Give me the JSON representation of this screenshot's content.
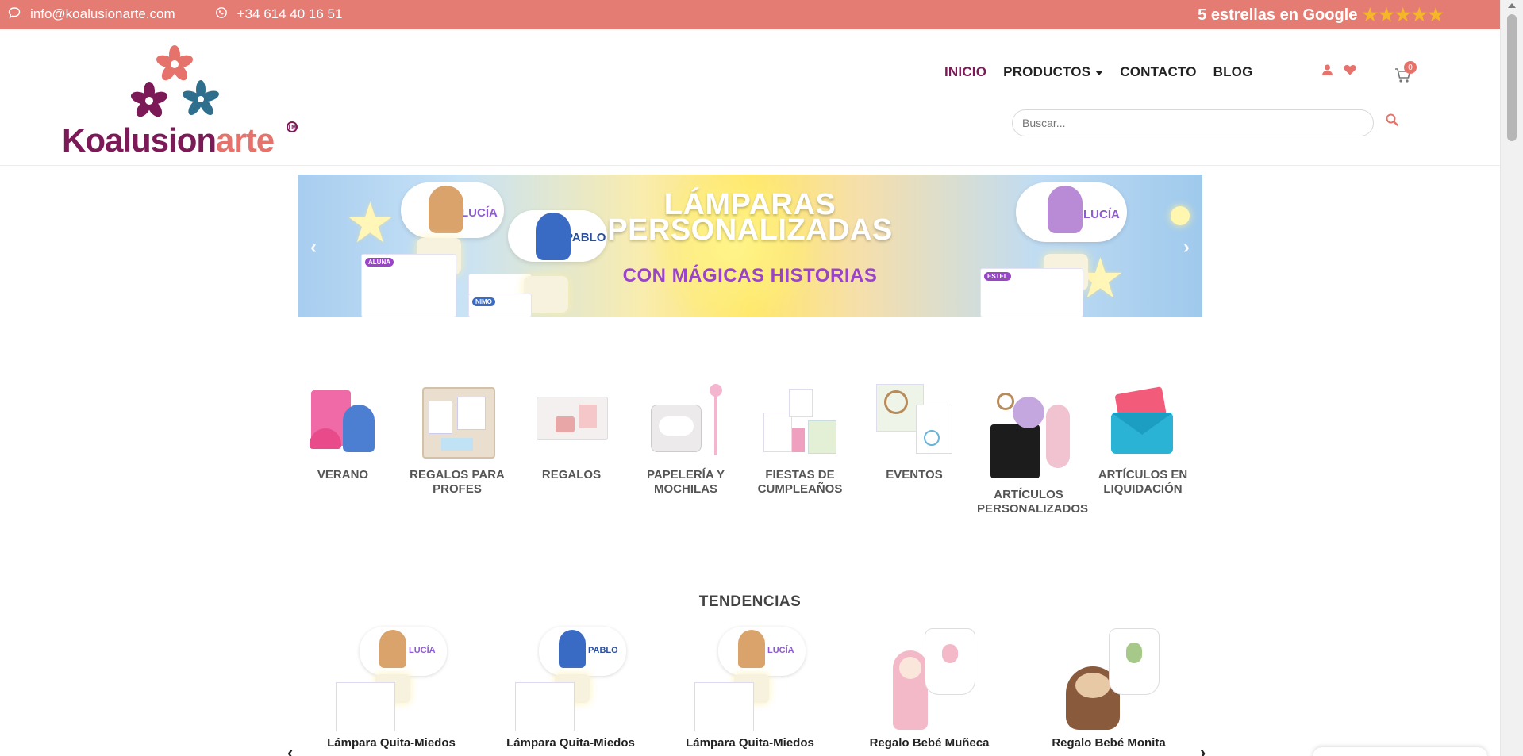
{
  "topbar": {
    "email": "info@koalusionarte.com",
    "phone": "+34 614 40 16 51",
    "rating_text": "5 estrellas en Google",
    "stars": "★★★★★"
  },
  "logo": {
    "word1": "Koalusion",
    "word2": "arte",
    "tm": "TM"
  },
  "nav": {
    "items": [
      "INICIO",
      "PRODUCTOS",
      "CONTACTO",
      "BLOG"
    ],
    "active": "INICIO"
  },
  "cart": {
    "count": "0"
  },
  "search": {
    "placeholder": "Buscar..."
  },
  "banner": {
    "title_line1": "LÁMPARAS",
    "title_line2": "PERSONALIZADAS",
    "subtitle": "CON MÁGICAS HISTORIAS",
    "names": [
      "LUCÍA",
      "PABLO",
      "LUCÍA"
    ],
    "cards": [
      "ALUNA",
      "NIMO",
      "ESTEL"
    ]
  },
  "categories": [
    {
      "label": "VERANO"
    },
    {
      "label": "REGALOS PARA PROFES"
    },
    {
      "label": "REGALOS"
    },
    {
      "label": "PAPELERÍA Y MOCHILAS"
    },
    {
      "label": "FIESTAS DE CUMPLEAÑOS"
    },
    {
      "label": "EVENTOS"
    },
    {
      "label": "ARTÍCULOS PERSONALIZADOS"
    },
    {
      "label": "ARTÍCULOS EN LIQUIDACIÓN"
    }
  ],
  "trending": {
    "title": "TENDENCIAS",
    "products": [
      {
        "name": "Lámpara Quita-Miedos",
        "tag": "LUCÍA"
      },
      {
        "name": "Lámpara Quita-Miedos",
        "tag": "PABLO"
      },
      {
        "name": "Lámpara Quita-Miedos",
        "tag": "LUCÍA"
      },
      {
        "name": "Regalo Bebé Muñeca",
        "tag": ""
      },
      {
        "name": "Regalo Bebé Monita",
        "tag": ""
      }
    ]
  },
  "colors": {
    "topbar": "#e57c73",
    "brand_purple": "#7b1a57",
    "brand_coral": "#e5736c",
    "star": "#f5b62b"
  },
  "icons": {
    "email": "chat-bubble-icon",
    "phone": "whatsapp-icon",
    "user": "user-icon",
    "wishlist": "heart-icon",
    "cart": "cart-icon",
    "search": "search-icon"
  }
}
